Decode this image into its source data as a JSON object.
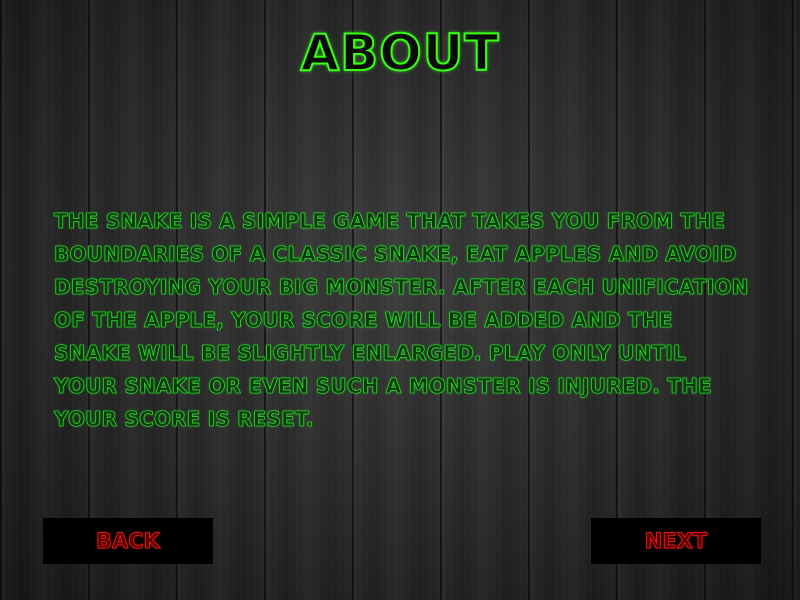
{
  "screen": {
    "title": "ABOUT",
    "body_text": "The snake is a simple game that takes you from the boundaries of a classic snake, eat apples and avoid destroying your big monster. After each unification of the apple, your score will be added and the snake will be slightly enlarged. Play only until your snake or even such a monster is injured. The your score is reset."
  },
  "buttons": {
    "back_label": "BACK",
    "next_label": "NEXT"
  },
  "colors": {
    "title_outline": "#39ff14",
    "text_green": "#2cf02c",
    "button_text_red": "#ff1a1a",
    "button_bg": "#000000",
    "background": "#262626"
  }
}
